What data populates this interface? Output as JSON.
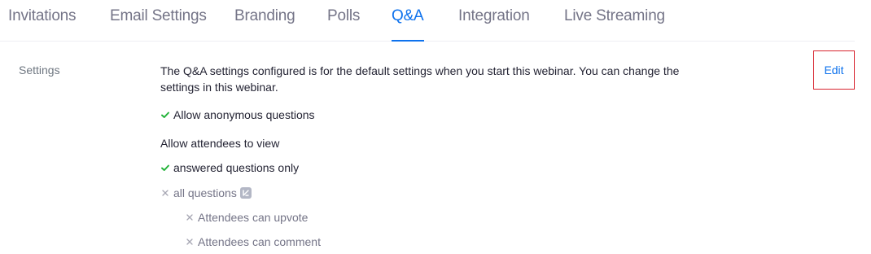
{
  "tabs": [
    {
      "label": "Invitations",
      "active": false
    },
    {
      "label": "Email Settings",
      "active": false
    },
    {
      "label": "Branding",
      "active": false
    },
    {
      "label": "Polls",
      "active": false
    },
    {
      "label": "Q&A",
      "active": true
    },
    {
      "label": "Integration",
      "active": false
    },
    {
      "label": "Live Streaming",
      "active": false
    }
  ],
  "settings": {
    "section_label": "Settings",
    "description": "The Q&A settings configured is for the default settings when you start this webinar. You can change the settings in this webinar.",
    "edit_label": "Edit",
    "items": [
      {
        "label": "Allow anonymous questions",
        "state": "enabled",
        "icon": "check-icon"
      },
      {
        "label": "Allow attendees to view",
        "state": "heading"
      },
      {
        "label": "answered questions only",
        "state": "enabled",
        "icon": "check-icon"
      },
      {
        "label": "all questions",
        "state": "disabled",
        "icon": "cross-icon",
        "badge": "info-icon"
      },
      {
        "label": "Attendees can upvote",
        "state": "disabled",
        "icon": "cross-icon"
      },
      {
        "label": "Attendees can comment",
        "state": "disabled",
        "icon": "cross-icon"
      }
    ]
  },
  "colors": {
    "accent": "#0e72ed",
    "check": "#23b33a",
    "muted": "#747487",
    "highlight_border": "#d8242f"
  }
}
